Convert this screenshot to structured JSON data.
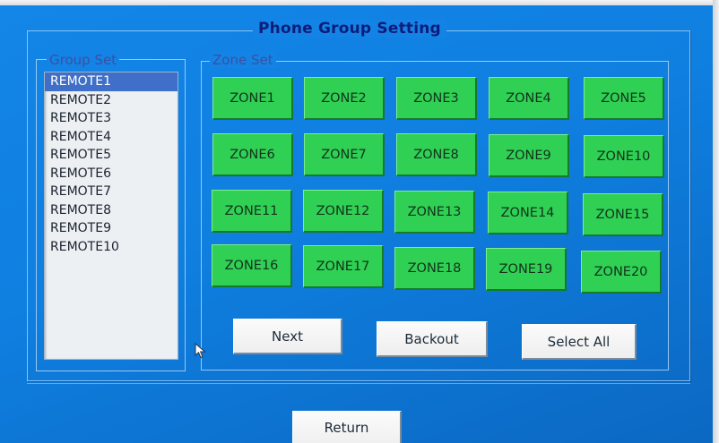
{
  "dialog": {
    "title": "Phone Group Setting"
  },
  "group_set": {
    "legend": "Group Set",
    "items": [
      {
        "label": "REMOTE1",
        "selected": true
      },
      {
        "label": "REMOTE2",
        "selected": false
      },
      {
        "label": "REMOTE3",
        "selected": false
      },
      {
        "label": "REMOTE4",
        "selected": false
      },
      {
        "label": "REMOTE5",
        "selected": false
      },
      {
        "label": "REMOTE6",
        "selected": false
      },
      {
        "label": "REMOTE7",
        "selected": false
      },
      {
        "label": "REMOTE8",
        "selected": false
      },
      {
        "label": "REMOTE9",
        "selected": false
      },
      {
        "label": "REMOTE10",
        "selected": false
      }
    ]
  },
  "zone_set": {
    "legend": "Zone Set",
    "zones": [
      "ZONE1",
      "ZONE2",
      "ZONE3",
      "ZONE4",
      "ZONE5",
      "ZONE6",
      "ZONE7",
      "ZONE8",
      "ZONE9",
      "ZONE10",
      "ZONE11",
      "ZONE12",
      "ZONE13",
      "ZONE14",
      "ZONE15",
      "ZONE16",
      "ZONE17",
      "ZONE18",
      "ZONE19",
      "ZONE20"
    ]
  },
  "actions": {
    "next_label": "Next",
    "backout_label": "Backout",
    "select_all_label": "Select All",
    "return_label": "Return"
  },
  "cursor": {
    "icon": "mouse-pointer-icon"
  },
  "colors": {
    "zone_button": "#2fd054",
    "selected_item": "#3f6fc9",
    "title_text": "#0d1d7a",
    "background": "#1384e6"
  }
}
